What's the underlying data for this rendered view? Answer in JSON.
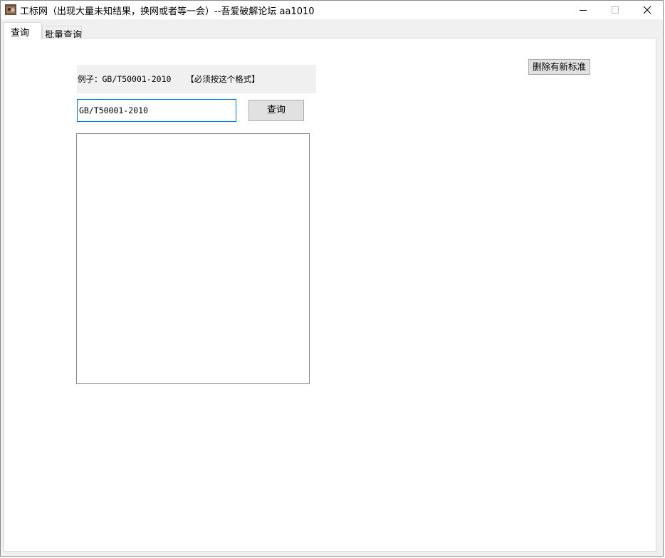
{
  "window": {
    "title": "工标网（出现大量未知结果，换网或者等一会）--吾爱破解论坛 aa1010",
    "icon": "app-icon",
    "controls": {
      "minimize": "minimize-icon",
      "maximize": "maximize-icon",
      "close": "close-icon"
    }
  },
  "tabs": [
    {
      "label": "查询",
      "active": true
    },
    {
      "label": "批量查询",
      "active": false
    }
  ],
  "query_panel": {
    "example_text": "例子：GB/T50001-2010   【必须按这个格式】",
    "input_value": "GB/T50001-2010",
    "query_button": "查询",
    "delete_button": "删除有新标准",
    "results": ""
  },
  "colors": {
    "window_bg": "#f0f0f0",
    "panel_bg": "#ffffff",
    "input_focus_border": "#0078d7",
    "button_bg": "#e1e1e1"
  }
}
